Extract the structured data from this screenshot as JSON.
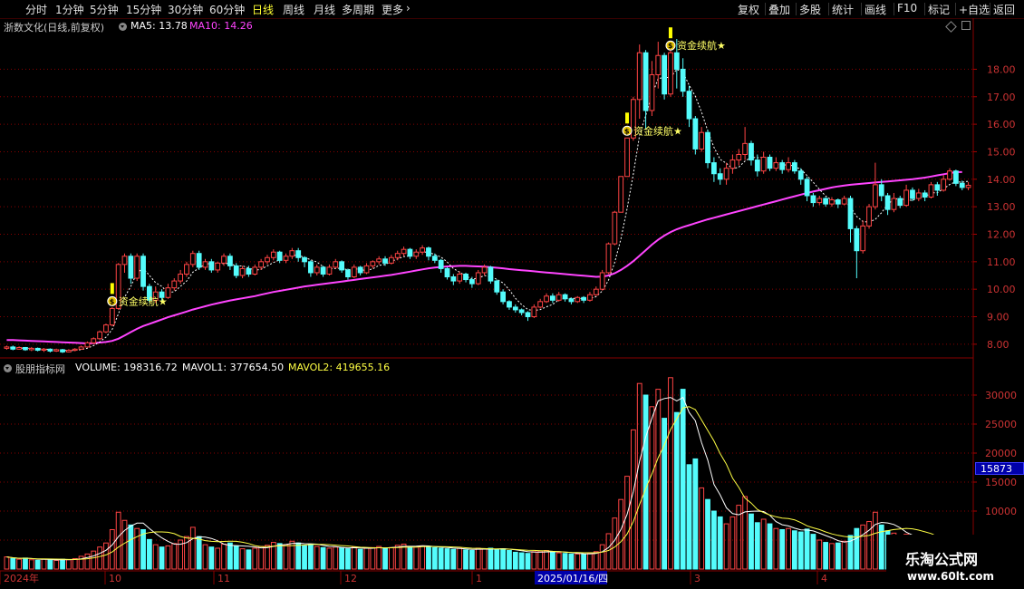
{
  "toolbar": {
    "left": [
      "分时",
      "1分钟",
      "5分钟",
      "15分钟",
      "30分钟",
      "60分钟",
      "日线",
      "周线",
      "月线",
      "多周期",
      "更多"
    ],
    "active": "日线",
    "more_icon": "chevron-right-icon",
    "right": [
      "复权",
      "叠加",
      "多股",
      "统计",
      "画线",
      "F10",
      "标记",
      "+自选",
      "返回"
    ]
  },
  "price_panel": {
    "stock_title": "浙数文化(日线,前复权)",
    "ma5_label": "MA5: 13.78",
    "ma10_label": "MA10: 14.26",
    "ma5_color": "#ffffff",
    "ma10_color": "#ff44ff",
    "y_ticks": [
      "18.00",
      "17.00",
      "16.00",
      "15.00",
      "14.00",
      "13.00",
      "12.00",
      "11.00",
      "10.00",
      "9.00",
      "8.00"
    ],
    "signal_label": "资金续航",
    "signal_star": "★",
    "signal_icon": "$"
  },
  "volume_panel": {
    "indicator_title": "股朋指标网",
    "volume_label": "VOLUME: 198316.72",
    "mavol1_label": "MAVOL1: 377654.50",
    "mavol2_label": "MAVOL2: 419655.16",
    "mavol1_color": "#ffffff",
    "mavol2_color": "#ffff44",
    "y_ticks": [
      "30000",
      "25000",
      "20000",
      "15000",
      "10000",
      "5000"
    ],
    "current_value": "15873"
  },
  "x_axis": {
    "labels": [
      "2024年",
      "10",
      "11",
      "12",
      "1",
      "3",
      "4"
    ],
    "highlight_date": "2025/01/16/四"
  },
  "watermark": {
    "line1": "乐淘公式网",
    "line2": "www.60lt.com"
  },
  "colors": {
    "up": "#ff4444",
    "down": "#54fcfc",
    "ma_line": "#ff44ff",
    "grid": "#880000",
    "signal_text": "#ffff66"
  },
  "chart_data": {
    "type": "candlestick",
    "price_axis": {
      "ylim": [
        7.6,
        19.2
      ]
    },
    "volume_axis": {
      "ylim": [
        0,
        35000
      ]
    },
    "volume_series": {
      "scale_multiplier_note": "",
      "current": 15873
    },
    "candles": [
      [
        7.85,
        7.9,
        7.8,
        7.95,
        2100
      ],
      [
        7.9,
        7.82,
        7.78,
        7.95,
        1800
      ],
      [
        7.82,
        7.88,
        7.8,
        7.92,
        1700
      ],
      [
        7.88,
        7.8,
        7.76,
        7.9,
        1900
      ],
      [
        7.8,
        7.85,
        7.75,
        7.9,
        1600
      ],
      [
        7.85,
        7.78,
        7.74,
        7.88,
        1500
      ],
      [
        7.78,
        7.82,
        7.72,
        7.86,
        1700
      ],
      [
        7.82,
        7.75,
        7.7,
        7.85,
        1600
      ],
      [
        7.75,
        7.8,
        7.72,
        7.84,
        1500
      ],
      [
        7.8,
        7.72,
        7.68,
        7.83,
        1700
      ],
      [
        7.72,
        7.78,
        7.7,
        7.82,
        1600
      ],
      [
        7.78,
        7.82,
        7.74,
        7.86,
        1800
      ],
      [
        7.82,
        7.9,
        7.8,
        7.95,
        2200
      ],
      [
        7.9,
        8.05,
        7.88,
        8.1,
        2600
      ],
      [
        8.05,
        8.2,
        8.0,
        8.25,
        3100
      ],
      [
        8.2,
        8.45,
        8.15,
        8.5,
        3800
      ],
      [
        8.45,
        8.7,
        8.4,
        8.75,
        4500
      ],
      [
        8.7,
        9.3,
        8.65,
        9.35,
        6800
      ],
      [
        9.3,
        10.9,
        9.25,
        10.95,
        9800
      ],
      [
        10.9,
        11.2,
        10.6,
        11.3,
        8400
      ],
      [
        11.2,
        10.4,
        10.2,
        11.3,
        7600
      ],
      [
        10.4,
        11.2,
        10.3,
        11.3,
        7000
      ],
      [
        11.2,
        10.1,
        9.95,
        11.3,
        6800
      ],
      [
        10.1,
        9.6,
        9.5,
        10.2,
        5100
      ],
      [
        9.6,
        9.9,
        9.5,
        10.1,
        4200
      ],
      [
        9.9,
        9.7,
        9.55,
        10.0,
        3800
      ],
      [
        9.7,
        10.05,
        9.65,
        10.2,
        4000
      ],
      [
        10.05,
        10.3,
        9.95,
        10.4,
        4400
      ],
      [
        10.3,
        10.55,
        10.2,
        10.7,
        5000
      ],
      [
        10.55,
        10.9,
        10.45,
        11.0,
        5600
      ],
      [
        10.9,
        11.3,
        10.8,
        11.4,
        7200
      ],
      [
        11.3,
        10.8,
        10.7,
        11.4,
        5600
      ],
      [
        10.8,
        11.0,
        10.7,
        11.1,
        4200
      ],
      [
        11.0,
        10.7,
        10.6,
        11.1,
        3800
      ],
      [
        10.7,
        10.95,
        10.6,
        11.0,
        3600
      ],
      [
        10.95,
        11.2,
        10.85,
        11.3,
        4300
      ],
      [
        11.2,
        10.85,
        10.7,
        11.3,
        4500
      ],
      [
        10.85,
        10.5,
        10.4,
        10.95,
        4000
      ],
      [
        10.5,
        10.75,
        10.4,
        10.85,
        3500
      ],
      [
        10.75,
        10.55,
        10.45,
        10.85,
        3300
      ],
      [
        10.55,
        10.8,
        10.5,
        10.9,
        3600
      ],
      [
        10.8,
        11.0,
        10.7,
        11.1,
        3900
      ],
      [
        11.0,
        11.15,
        10.9,
        11.25,
        4100
      ],
      [
        11.15,
        11.35,
        11.05,
        11.45,
        4600
      ],
      [
        11.35,
        11.05,
        10.95,
        11.4,
        4400
      ],
      [
        11.05,
        11.2,
        10.95,
        11.3,
        4200
      ],
      [
        11.2,
        11.4,
        11.1,
        11.5,
        4800
      ],
      [
        11.4,
        11.15,
        11.0,
        11.5,
        4500
      ],
      [
        11.15,
        11.0,
        10.8,
        11.2,
        4000
      ],
      [
        11.0,
        10.6,
        10.45,
        11.05,
        4300
      ],
      [
        10.6,
        10.8,
        10.5,
        10.9,
        3900
      ],
      [
        10.8,
        10.55,
        10.45,
        10.85,
        3700
      ],
      [
        10.55,
        10.8,
        10.5,
        10.9,
        3600
      ],
      [
        10.8,
        11.0,
        10.75,
        11.1,
        3800
      ],
      [
        11.0,
        10.7,
        10.6,
        11.05,
        3700
      ],
      [
        10.7,
        10.45,
        10.35,
        10.75,
        3500
      ],
      [
        10.45,
        10.8,
        10.4,
        10.9,
        3800
      ],
      [
        10.8,
        10.6,
        10.5,
        10.85,
        3400
      ],
      [
        10.6,
        10.85,
        10.55,
        10.95,
        3600
      ],
      [
        10.85,
        11.0,
        10.75,
        11.05,
        3700
      ],
      [
        11.0,
        11.1,
        10.9,
        11.2,
        3900
      ],
      [
        11.1,
        10.95,
        10.85,
        11.2,
        3600
      ],
      [
        10.95,
        11.15,
        10.9,
        11.25,
        3700
      ],
      [
        11.15,
        11.3,
        11.05,
        11.4,
        4100
      ],
      [
        11.3,
        11.45,
        11.2,
        11.55,
        4300
      ],
      [
        11.45,
        11.2,
        11.1,
        11.5,
        3900
      ],
      [
        11.2,
        11.35,
        11.1,
        11.45,
        3800
      ],
      [
        11.35,
        11.5,
        11.25,
        11.6,
        4000
      ],
      [
        11.5,
        11.2,
        11.05,
        11.55,
        3900
      ],
      [
        11.2,
        11.05,
        10.95,
        11.3,
        3700
      ],
      [
        11.05,
        10.75,
        10.6,
        11.1,
        3600
      ],
      [
        10.75,
        10.45,
        10.35,
        10.8,
        3500
      ],
      [
        10.45,
        10.3,
        10.15,
        10.55,
        3400
      ],
      [
        10.3,
        10.55,
        10.2,
        10.65,
        3600
      ],
      [
        10.55,
        10.35,
        10.25,
        10.6,
        3300
      ],
      [
        10.35,
        10.2,
        10.05,
        10.45,
        3200
      ],
      [
        10.2,
        10.6,
        10.15,
        10.7,
        3600
      ],
      [
        10.6,
        10.8,
        10.5,
        10.9,
        3500
      ],
      [
        10.8,
        10.3,
        10.2,
        10.85,
        3600
      ],
      [
        10.3,
        9.9,
        9.8,
        10.35,
        3400
      ],
      [
        9.9,
        9.55,
        9.45,
        10.0,
        3500
      ],
      [
        9.55,
        9.35,
        9.25,
        9.6,
        3200
      ],
      [
        9.35,
        9.25,
        9.15,
        9.45,
        2900
      ],
      [
        9.25,
        9.15,
        9.05,
        9.3,
        2800
      ],
      [
        9.15,
        9.0,
        8.85,
        9.2,
        2700
      ],
      [
        9.0,
        9.35,
        8.95,
        9.45,
        3000
      ],
      [
        9.35,
        9.55,
        9.3,
        9.65,
        3100
      ],
      [
        9.55,
        9.75,
        9.5,
        9.85,
        3200
      ],
      [
        9.75,
        9.6,
        9.5,
        9.85,
        2900
      ],
      [
        9.6,
        9.8,
        9.55,
        9.9,
        2800
      ],
      [
        9.8,
        9.65,
        9.55,
        9.85,
        2700
      ],
      [
        9.65,
        9.55,
        9.45,
        9.7,
        2600
      ],
      [
        9.55,
        9.7,
        9.5,
        9.75,
        2600
      ],
      [
        9.7,
        9.6,
        9.5,
        9.75,
        2500
      ],
      [
        9.6,
        9.8,
        9.55,
        9.9,
        2700
      ],
      [
        9.8,
        10.0,
        9.75,
        10.1,
        3000
      ],
      [
        10.0,
        10.6,
        9.95,
        10.7,
        4200
      ],
      [
        10.6,
        11.65,
        10.55,
        11.7,
        6100
      ],
      [
        11.65,
        12.8,
        11.6,
        12.85,
        8800
      ],
      [
        12.8,
        14.1,
        12.8,
        14.1,
        12000
      ],
      [
        14.1,
        15.5,
        14.1,
        15.5,
        16000
      ],
      [
        15.5,
        16.9,
        15.4,
        17.0,
        24000
      ],
      [
        16.9,
        18.6,
        16.2,
        18.9,
        32000
      ],
      [
        18.6,
        16.5,
        15.8,
        18.7,
        30000
      ],
      [
        16.5,
        17.8,
        16.3,
        18.3,
        28000
      ],
      [
        17.8,
        18.5,
        17.3,
        19.0,
        31000
      ],
      [
        18.5,
        17.1,
        16.9,
        18.6,
        26000
      ],
      [
        17.1,
        18.6,
        17.0,
        19.0,
        33000
      ],
      [
        18.6,
        18.0,
        17.3,
        19.1,
        27000
      ],
      [
        18.0,
        17.2,
        17.0,
        18.4,
        31000
      ],
      [
        17.2,
        16.2,
        15.9,
        17.4,
        18000
      ],
      [
        16.2,
        15.1,
        14.9,
        16.3,
        19000
      ],
      [
        15.1,
        15.7,
        15.0,
        15.9,
        14000
      ],
      [
        15.7,
        14.6,
        14.4,
        15.8,
        12000
      ],
      [
        14.6,
        14.2,
        13.9,
        14.8,
        10000
      ],
      [
        14.2,
        14.0,
        13.8,
        14.4,
        9000
      ],
      [
        14.0,
        14.4,
        13.8,
        14.6,
        7800
      ],
      [
        14.4,
        14.7,
        14.2,
        14.9,
        9000
      ],
      [
        14.7,
        14.9,
        14.5,
        15.1,
        11000
      ],
      [
        14.9,
        15.3,
        14.7,
        15.9,
        12500
      ],
      [
        15.3,
        14.7,
        14.5,
        15.4,
        9500
      ],
      [
        14.7,
        14.3,
        14.1,
        14.9,
        8000
      ],
      [
        14.3,
        14.8,
        14.2,
        15.0,
        8600
      ],
      [
        14.8,
        14.4,
        14.3,
        14.9,
        7800
      ],
      [
        14.4,
        14.6,
        14.3,
        14.8,
        7000
      ],
      [
        14.6,
        14.35,
        14.2,
        14.7,
        6800
      ],
      [
        14.35,
        14.6,
        14.25,
        14.8,
        7000
      ],
      [
        14.6,
        14.3,
        14.2,
        14.7,
        6600
      ],
      [
        14.3,
        14.0,
        13.8,
        14.4,
        6400
      ],
      [
        14.0,
        13.4,
        13.2,
        14.1,
        6900
      ],
      [
        13.4,
        13.15,
        13.0,
        13.5,
        6000
      ],
      [
        13.15,
        13.3,
        13.05,
        13.4,
        5000
      ],
      [
        13.3,
        13.1,
        13.0,
        13.35,
        4600
      ],
      [
        13.1,
        13.25,
        13.0,
        13.35,
        4400
      ],
      [
        13.25,
        13.1,
        12.95,
        13.3,
        4500
      ],
      [
        13.1,
        13.3,
        13.05,
        13.4,
        4800
      ],
      [
        13.3,
        12.2,
        11.7,
        13.4,
        5800
      ],
      [
        12.2,
        11.4,
        10.4,
        12.3,
        7000
      ],
      [
        11.4,
        12.3,
        11.3,
        12.5,
        7600
      ],
      [
        12.3,
        13.0,
        12.2,
        13.1,
        8200
      ],
      [
        13.0,
        13.8,
        12.9,
        14.6,
        9800
      ],
      [
        13.8,
        13.4,
        13.2,
        14.0,
        7600
      ],
      [
        13.4,
        12.9,
        12.7,
        13.5,
        6600
      ],
      [
        12.9,
        13.3,
        12.8,
        13.5,
        6200
      ],
      [
        13.3,
        13.05,
        12.95,
        13.4,
        5400
      ],
      [
        13.05,
        13.6,
        13.0,
        13.8,
        6000
      ],
      [
        13.6,
        13.3,
        13.2,
        13.7,
        5000
      ],
      [
        13.3,
        13.5,
        13.2,
        13.65,
        4800
      ],
      [
        13.5,
        13.35,
        13.2,
        13.6,
        4600
      ],
      [
        13.35,
        13.8,
        13.3,
        13.9,
        5200
      ],
      [
        13.8,
        13.6,
        13.4,
        13.9,
        4800
      ],
      [
        13.6,
        14.0,
        13.55,
        14.15,
        5600
      ],
      [
        14.0,
        14.3,
        13.95,
        14.4,
        5800
      ],
      [
        14.3,
        13.85,
        13.75,
        14.35,
        5400
      ],
      [
        13.85,
        13.7,
        13.6,
        13.95,
        4900
      ],
      [
        13.7,
        13.78,
        13.6,
        13.9,
        4200
      ]
    ],
    "ma10": [
      8.15,
      8.15,
      8.14,
      8.13,
      8.12,
      8.11,
      8.1,
      8.09,
      8.08,
      8.07,
      8.06,
      8.05,
      8.04,
      8.03,
      8.04,
      8.06,
      8.08,
      8.12,
      8.2,
      8.32,
      8.44,
      8.56,
      8.66,
      8.74,
      8.82,
      8.9,
      8.98,
      9.05,
      9.12,
      9.19,
      9.26,
      9.32,
      9.38,
      9.44,
      9.49,
      9.54,
      9.59,
      9.63,
      9.67,
      9.71,
      9.75,
      9.8,
      9.85,
      9.9,
      9.94,
      9.98,
      10.02,
      10.06,
      10.1,
      10.13,
      10.16,
      10.19,
      10.22,
      10.25,
      10.28,
      10.31,
      10.34,
      10.37,
      10.4,
      10.43,
      10.46,
      10.49,
      10.52,
      10.56,
      10.6,
      10.64,
      10.68,
      10.72,
      10.76,
      10.79,
      10.81,
      10.83,
      10.84,
      10.85,
      10.85,
      10.84,
      10.83,
      10.82,
      10.8,
      10.78,
      10.76,
      10.73,
      10.71,
      10.69,
      10.67,
      10.65,
      10.63,
      10.61,
      10.59,
      10.57,
      10.55,
      10.53,
      10.51,
      10.49,
      10.47,
      10.45,
      10.46,
      10.5,
      10.58,
      10.7,
      10.85,
      11.02,
      11.22,
      11.42,
      11.62,
      11.8,
      11.95,
      12.08,
      12.18,
      12.26,
      12.33,
      12.4,
      12.47,
      12.54,
      12.6,
      12.66,
      12.72,
      12.78,
      12.84,
      12.9,
      12.96,
      13.02,
      13.08,
      13.14,
      13.2,
      13.26,
      13.32,
      13.38,
      13.44,
      13.5,
      13.55,
      13.6,
      13.65,
      13.7,
      13.74,
      13.77,
      13.8,
      13.82,
      13.84,
      13.86,
      13.88,
      13.9,
      13.92,
      13.94,
      13.96,
      13.98,
      14.0,
      14.03,
      14.06,
      14.1,
      14.14,
      14.18,
      14.22,
      14.26,
      14.26
    ],
    "signals": [
      17,
      100,
      107
    ]
  }
}
